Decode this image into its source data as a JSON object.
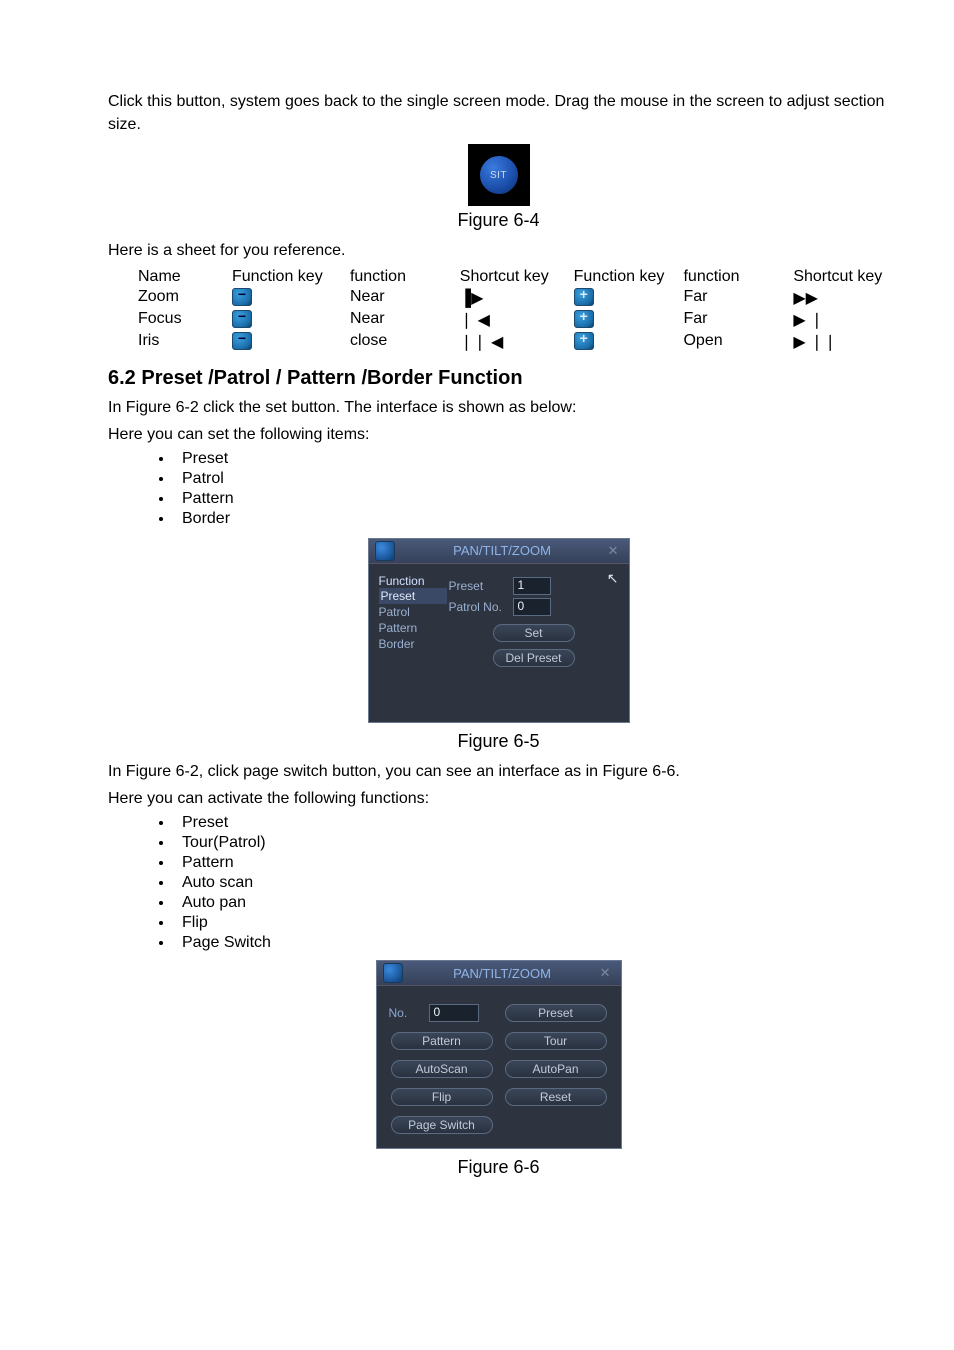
{
  "intro_text": "Click this button, system goes back to the single screen mode. Drag the mouse in the screen to adjust section size.",
  "sit_label": "SIT",
  "fig64_caption": "Figure 6-4",
  "sheet_intro": "Here is a sheet for you reference.",
  "table": {
    "headers": [
      "Name",
      "Function key",
      "function",
      "Shortcut key",
      "Function key",
      "function",
      "Shortcut key"
    ],
    "rows": [
      {
        "name": "Zoom",
        "fn1": "Near",
        "sk1": "▐▶",
        "fn2": "Far",
        "sk2": "▶▶"
      },
      {
        "name": "Focus",
        "fn1": "Near",
        "sk1": "❘ ◀",
        "fn2": "Far",
        "sk2": "▶ ❘"
      },
      {
        "name": "Iris",
        "fn1": "close",
        "sk1": "❘❘ ◀",
        "fn2": "Open",
        "sk2": "▶ ❘❘"
      }
    ]
  },
  "section_heading": "6.2  Preset  /Patrol / Pattern /Border  Function",
  "sec_line1": "In Figure 6-2 click the set button. The interface is shown as below:",
  "sec_line2": "Here you can set the following items:",
  "list1": [
    "Preset",
    "Patrol",
    "Pattern",
    "Border"
  ],
  "ptz1": {
    "title": "PAN/TILT/ZOOM",
    "left_label": "Function",
    "list": [
      "Preset",
      "Patrol",
      "Pattern",
      "Border"
    ],
    "preset_label": "Preset",
    "preset_value": "1",
    "patrol_label": "Patrol No.",
    "patrol_value": "0",
    "set_btn": "Set",
    "del_btn": "Del Preset"
  },
  "fig65_caption": "Figure 6-5",
  "sec2_line1": "In Figure 6-2, click page switch button, you can see an interface as in Figure 6-6.",
  "sec2_line2": "Here you can activate the following functions:",
  "list2": [
    "Preset",
    "Tour(Patrol)",
    "Pattern",
    "Auto scan",
    "Auto pan",
    "Flip",
    "Page Switch"
  ],
  "ptz2": {
    "title": "PAN/TILT/ZOOM",
    "no_label": "No.",
    "no_value": "0",
    "buttons": {
      "preset": "Preset",
      "pattern": "Pattern",
      "tour": "Tour",
      "autoscan": "AutoScan",
      "autopan": "AutoPan",
      "flip": "Flip",
      "reset": "Reset",
      "pageswitch": "Page Switch"
    }
  },
  "fig66_caption": "Figure 6-6"
}
